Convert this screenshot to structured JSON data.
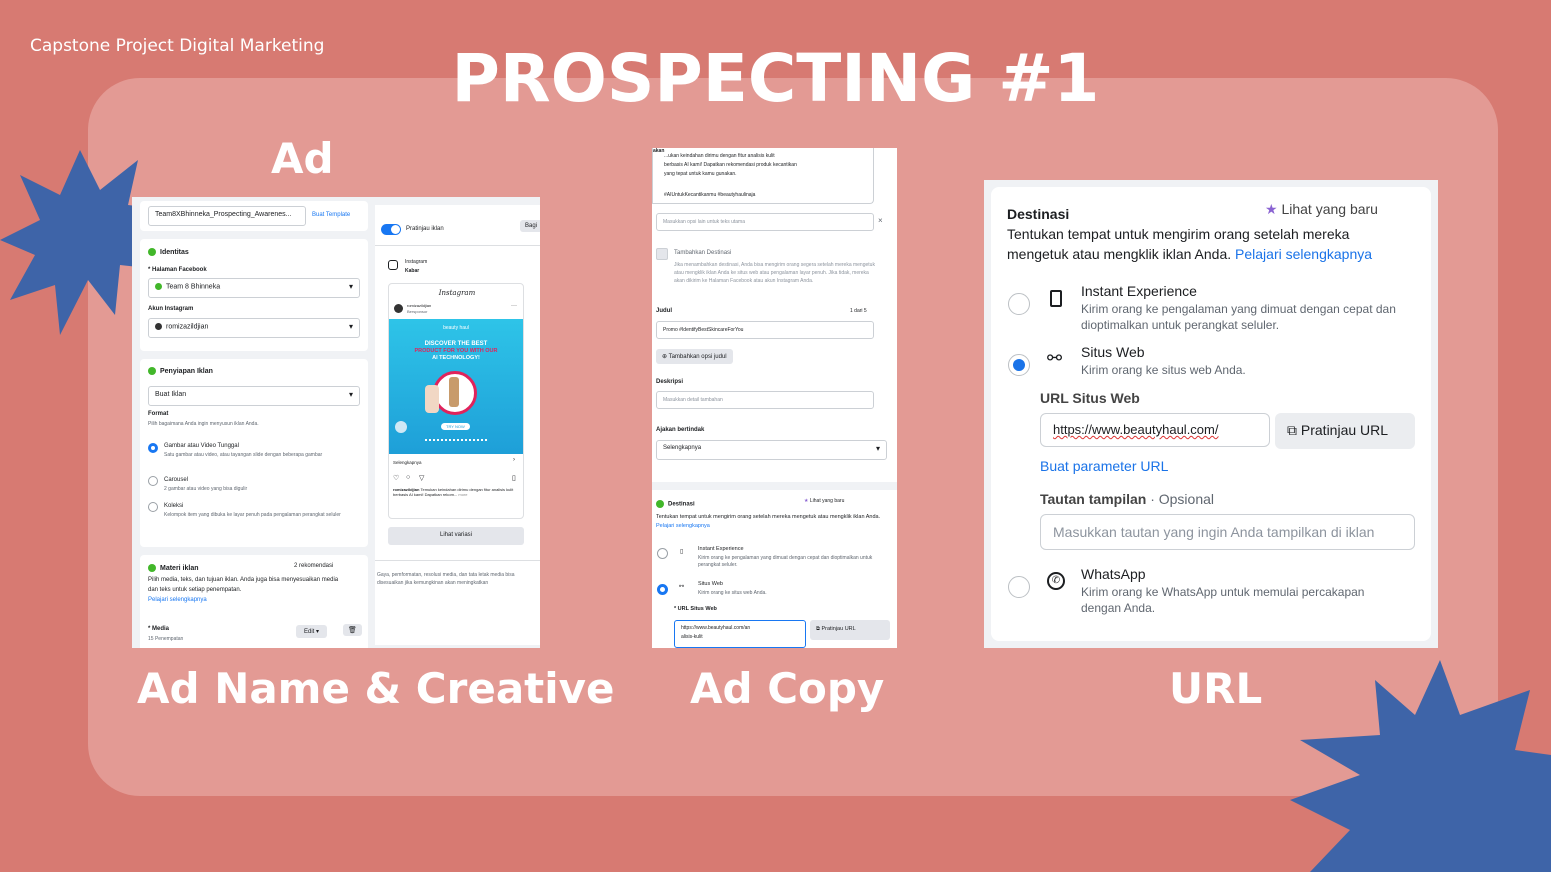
{
  "slide": {
    "top_label": "Capstone Project Digital Marketing",
    "title": "PROSPECTING #1",
    "heading_ad": "Ad",
    "caption_1": "Ad Name & Creative",
    "caption_2": "Ad Copy",
    "caption_3": "URL",
    "colors": {
      "background": "#d77a72",
      "panel": "#e39a94",
      "star": "#3e64a8"
    }
  },
  "shot1": {
    "ad_name": "Team8XBhinneka_Prospecting_Awarenes...",
    "buat_template": "Buat Template",
    "identitas": "Identitas",
    "halaman_facebook_label": "* Halaman Facebook",
    "halaman_facebook_value": "Team 8 Bhinneka",
    "akun_instagram_label": "Akun Instagram",
    "akun_instagram_value": "romizazildjian",
    "penyiapan_iklan": "Penyiapan Iklan",
    "buat_iklan": "Buat Iklan",
    "format_label": "Format",
    "format_desc": "Pilih bagaimana Anda ingin menyusun iklan Anda.",
    "opt1_title": "Gambar atau Video Tunggal",
    "opt1_desc": "Satu gambar atau video, atau tayangan slide dengan beberapa gambar",
    "opt2_title": "Carousel",
    "opt2_desc": "2 gambar atau video yang bisa digulir",
    "opt3_title": "Koleksi",
    "opt3_desc": "Kelompok item yang dibuka ke layar penuh pada pengalaman perangkat seluler",
    "materi_iklan": "Materi iklan",
    "rekomendasi": "2 rekomendasi",
    "materi_desc": "Pilih media, teks, dan tujuan iklan. Anda juga bisa menyesuaikan media dan teks untuk setiap penempatan.",
    "pelajari": "Pelajari selengkapnya",
    "media_label": "* Media",
    "media_sub": "15 Penempatan",
    "edit_button": "Edit",
    "pratinjau_iklan": "Pratinjau iklan",
    "bagikan": "Bagi",
    "instagram_label": "Instagram",
    "kabar_label": "Kabar",
    "instagram_logo": "Instagram",
    "account_name": "romizazildjian",
    "sponsored": "Bersponsor",
    "creative_brand": "beauty haul",
    "creative_headline_1": "DISCOVER THE BEST",
    "creative_headline_2": "PRODUCT FOR YOU WITH OUR",
    "creative_headline_3": "AI TECHNOLOGY!",
    "creative_cta": "TRY NOW",
    "selengkapnya": "Selengkapnya",
    "caption_user": "romizazildjian",
    "caption_text": "Temukan keindahan dirimu dengan fitur analisis kulit berbasis AI kami! Dapatkan rekom...",
    "more": "more",
    "lihat_variasi": "Lihat variasi",
    "footer_note": "Gaya, pemformatan, resolusi media, dan tata letak media bisa disesuaikan jika kemungkinan akan meningkatkan"
  },
  "shot2": {
    "tab_fragment": "akan",
    "text_top_1": "...ukan keindahan dirimu dengan fitur analisis kulit",
    "text_top_2": "berbasis AI kami! Dapatkan rekomendasi produk kecantikan",
    "text_top_3": "yang tepat untuk kamu gunakan.",
    "hashtags": "#AIUntukKecantikanmu #beautyhaulinaja",
    "opsi_placeholder": "Masukkan opsi lain untuk teks utama",
    "tambahkan_destinasi": "Tambahkan Destinasi",
    "destinasi_note": "Jika menambahkan destinasi, Anda bisa mengirim orang segera setelah mereka mengetuk atau mengklik iklan Anda ke situs web atau pengalaman layar penuh. Jika tidak, mereka akan dikirim ke Halaman Facebook atau akun Instagram Anda.",
    "judul_label": "Judul",
    "judul_count": "1 dari 5",
    "judul_value": "Promo #IdentifyBestSkincareForYou",
    "tambah_judul": "Tambahkan opsi judul",
    "deskripsi_label": "Deskripsi",
    "deskripsi_placeholder": "Masukkan detail tambahan",
    "ajakan_label": "Ajakan bertindak",
    "ajakan_value": "Selengkapnya",
    "destinasi": "Destinasi",
    "lihat_baru": "Lihat yang baru",
    "dest_desc": "Tentukan tempat untuk mengirim orang setelah mereka mengetuk atau mengklik iklan Anda.",
    "pelajari": "Pelajari selengkapnya",
    "instant_title": "Instant Experience",
    "instant_desc": "Kirim orang ke pengalaman yang dimuat dengan cepat dan dioptimalkan untuk perangkat seluler.",
    "situs_title": "Situs Web",
    "situs_desc": "Kirim orang ke situs web Anda.",
    "url_label": "* URL Situs Web",
    "url_value_1": "https://www.beautyhaul.com/an",
    "url_value_2": "alisis-kulit",
    "pratinjau_url": "Pratinjau URL"
  },
  "shot3": {
    "destinasi": "Destinasi",
    "lihat_baru": "Lihat yang baru",
    "desc_1": "Tentukan tempat untuk mengirim orang setelah mereka",
    "desc_2": "mengetuk atau mengklik iklan Anda.",
    "pelajari": "Pelajari selengkapnya",
    "instant_title": "Instant Experience",
    "instant_desc_1": "Kirim orang ke pengalaman yang dimuat dengan cepat dan",
    "instant_desc_2": "dioptimalkan untuk perangkat seluler.",
    "situs_title": "Situs Web",
    "situs_desc": "Kirim orang ke situs web Anda.",
    "url_label": "URL Situs Web",
    "url_value": "https://www.beautyhaul.com/",
    "pratinjau_url": "Pratinjau URL",
    "buat_parameter": "Buat parameter URL",
    "tautan_label": "Tautan tampilan",
    "opsional": " · Opsional",
    "tautan_placeholder": "Masukkan tautan yang ingin Anda tampilkan di iklan",
    "whatsapp_title": "WhatsApp",
    "whatsapp_desc_1": "Kirim orang ke WhatsApp untuk memulai percakapan",
    "whatsapp_desc_2": "dengan Anda."
  }
}
